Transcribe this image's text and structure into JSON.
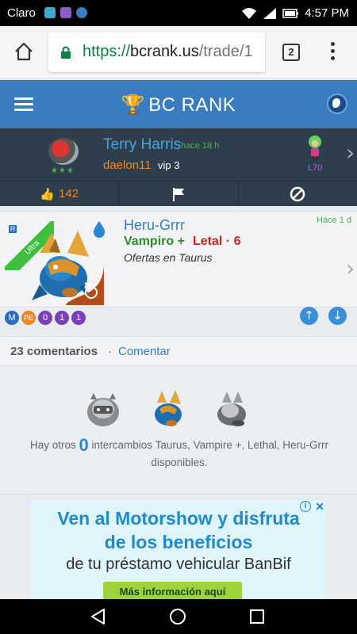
{
  "status_bar": {
    "carrier": "Claro",
    "time": "4:57 PM"
  },
  "browser": {
    "url_scheme": "https://",
    "url_host": "bcrank.us",
    "url_path": "/trade/1",
    "tab_count": "2"
  },
  "header": {
    "brand": "BC RANK"
  },
  "user": {
    "name": "Terry Harris",
    "time_ago": "hace 18 h",
    "handle": "daelon11",
    "vip": "vip 3",
    "stars": "★★★",
    "level": "L70",
    "likes": "142"
  },
  "trade": {
    "ribbon_label": "Ultra",
    "ribbon_letter": "R",
    "name": "Heru-Grrr",
    "time_ago": "Hace 1 d",
    "tag1": "Vampiro +",
    "tag2": "Letal · 6",
    "offer": "Ofertas en Taurus",
    "badges": [
      {
        "text": "M",
        "color": "#2a6dc0"
      },
      {
        "text": "PE",
        "color": "#e8882a"
      },
      {
        "text": "0",
        "color": "#7b3fb8"
      },
      {
        "text": "1",
        "color": "#7b3fb8"
      },
      {
        "text": "1",
        "color": "#7b3fb8"
      }
    ]
  },
  "comments": {
    "count_label": "23 comentarios",
    "separator": "·",
    "comment_link": "Comentar"
  },
  "similar": {
    "prefix": "Hay otros",
    "count": "0",
    "suffix": "intercambios Taurus, Vampire +, Lethal, Heru-Grrr disponibles."
  },
  "ad": {
    "line1": "Ven al Motorshow y disfruta",
    "line2": "de los beneficios",
    "line3": "de tu préstamo vehicular BanBif",
    "cta": "Más información aquí",
    "info": "i",
    "close": "✕"
  },
  "icons": {
    "like": "thumbs-up-icon",
    "report": "flag-icon",
    "block": "ban-icon"
  }
}
